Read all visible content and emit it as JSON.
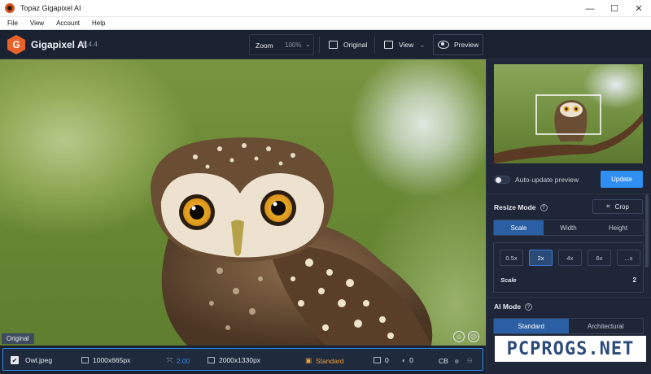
{
  "window": {
    "title": "Topaz Gigapixel AI",
    "minimize": "—",
    "maximize": "☐",
    "close": "✕"
  },
  "menu": [
    "File",
    "View",
    "Account",
    "Help"
  ],
  "header": {
    "app_name": "Gigapixel AI",
    "version": "v5.4.4",
    "zoom_label": "Zoom",
    "zoom_value": "100%",
    "original_label": "Original",
    "view_label": "View",
    "preview_label": "Preview"
  },
  "viewport": {
    "overlay_label": "Original"
  },
  "panel": {
    "auto_update_label": "Auto-update preview",
    "update_button": "Update",
    "resize_mode_label": "Resize Mode",
    "crop_label": "Crop",
    "resize_tabs": [
      "Scale",
      "Width",
      "Height"
    ],
    "scale_buttons": [
      "0.5x",
      "2x",
      "4x",
      "6x",
      "...x"
    ],
    "scale_label": "Scale",
    "scale_value": "2",
    "ai_mode_label": "AI Mode",
    "ai_tabs": [
      "Standard",
      "Architectural"
    ]
  },
  "file": {
    "name": "Owl.jpeg",
    "input_size": "1000x665px",
    "scale": "2.00",
    "output_size": "2000x1330px",
    "mode": "Standard",
    "noise": "0",
    "blur": "0",
    "cb": "CB"
  },
  "watermark": "PCPROGS.NET",
  "colors": {
    "accent": "#2f8ff0",
    "background": "#1b2230",
    "mode_orange": "#f0a23a"
  }
}
